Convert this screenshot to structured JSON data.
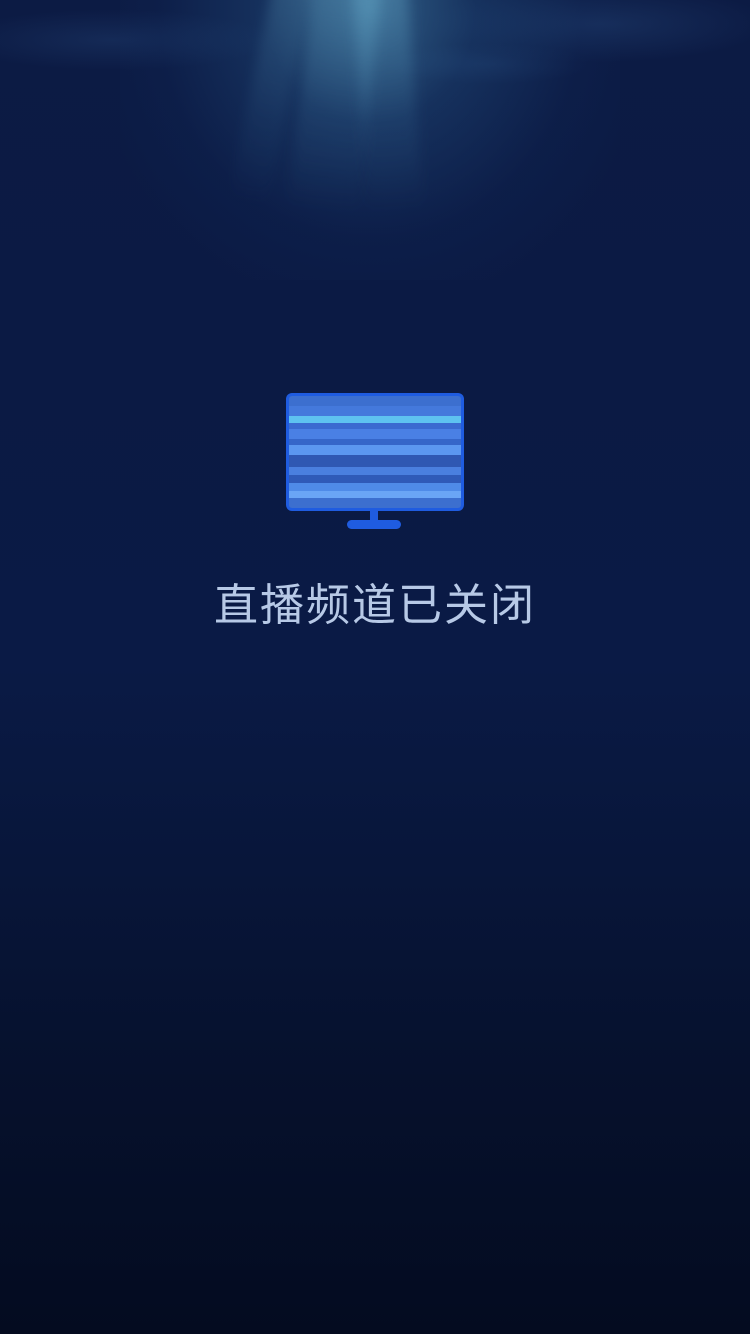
{
  "screen": {
    "background": "underwater-ocean-backdrop",
    "status_message": "直播频道已关闭"
  },
  "icon": {
    "name": "tv-static-icon",
    "frame_color": "#1f5ce0",
    "stripe_colors": [
      "#3c6fcf",
      "#5ec2f0",
      "#4a86e6",
      "#2f58b3",
      "#6aa5f5"
    ]
  },
  "colors": {
    "text": "#b7c9e6",
    "background_top": "#0c1b44",
    "background_bottom": "#040b20"
  }
}
